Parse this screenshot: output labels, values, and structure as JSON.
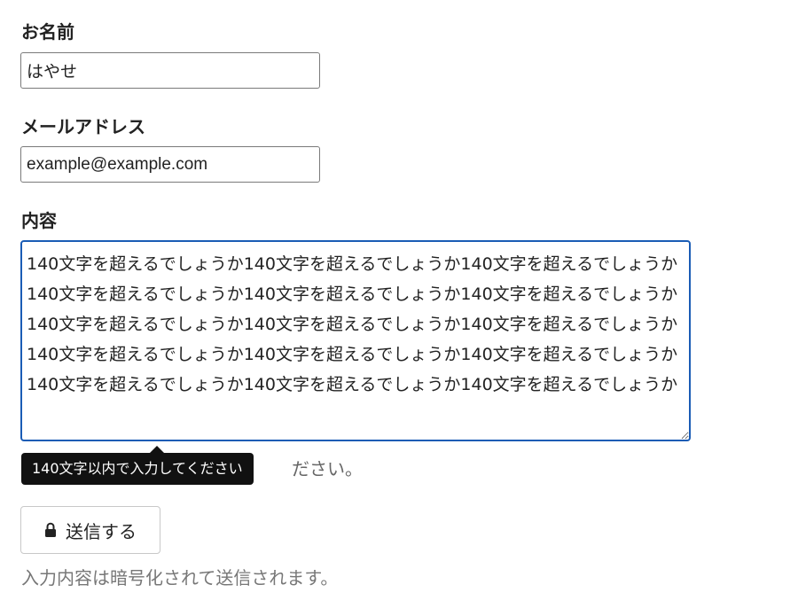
{
  "form": {
    "name_label": "お名前",
    "name_value": "はやせ",
    "email_label": "メールアドレス",
    "email_value": "example@example.com",
    "content_label": "内容",
    "content_value": "140文字を超えるでしょうか140文字を超えるでしょうか140文字を超えるでしょうか140文字を超えるでしょうか140文字を超えるでしょうか140文字を超えるでしょうか140文字を超えるでしょうか140文字を超えるでしょうか140文字を超えるでしょうか140文字を超えるでしょうか140文字を超えるでしょうか140文字を超えるでしょうか140文字を超えるでしょうか140文字を超えるでしょうか140文字を超えるでしょうか",
    "hint_visible_tail": "ださい。",
    "validation_tooltip": "140文字以内で入力してください",
    "submit_label": "送信する",
    "submit_icon": "lock-icon",
    "note": "入力内容は暗号化されて送信されます。"
  },
  "colors": {
    "focus_border": "#1a5cb5",
    "tooltip_bg": "#111111",
    "hint_text": "#666666"
  }
}
